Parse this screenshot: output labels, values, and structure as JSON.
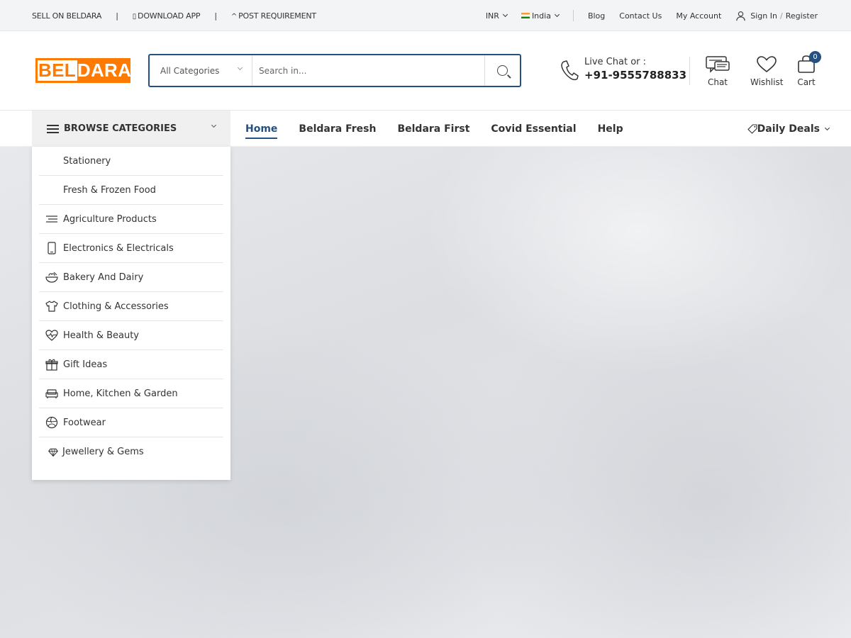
{
  "topbar": {
    "sell": "SELL ON BELDARA",
    "sep": "|",
    "download": "DOWNLOAD APP",
    "post": "POST REQUIREMENT",
    "currency": "INR",
    "country": "India",
    "blog": "Blog",
    "contact": "Contact Us",
    "account": "My Account",
    "signin": "Sign In",
    "slash": "/",
    "register": "Register"
  },
  "header": {
    "logo_part1": "BEL",
    "logo_part2": "DARA",
    "search_category": "All Categories",
    "search_placeholder": "Search in...",
    "contact_line1": "Live Chat or :",
    "contact_phone": "+91-9555788833",
    "chat_label": "Chat",
    "wishlist_label": "Wishlist",
    "cart_label": "Cart",
    "cart_count": "0"
  },
  "nav": {
    "browse_label": "BROWSE CATEGORIES",
    "items": [
      {
        "label": "Home"
      },
      {
        "label": "Beldara Fresh"
      },
      {
        "label": "Beldara First"
      },
      {
        "label": "Covid Essential"
      },
      {
        "label": "Help"
      }
    ],
    "deals_label": "Daily Deals"
  },
  "categories": [
    {
      "label": "Stationery",
      "icon": "none"
    },
    {
      "label": "Fresh & Frozen Food",
      "icon": "none"
    },
    {
      "label": "Agriculture Products",
      "icon": "lines-icon"
    },
    {
      "label": "Electronics & Electricals",
      "icon": "phone-device-icon"
    },
    {
      "label": "Bakery And Dairy",
      "icon": "bowl-icon"
    },
    {
      "label": "Clothing & Accessories",
      "icon": "tshirt-icon"
    },
    {
      "label": "Health & Beauty",
      "icon": "heart-pulse-icon"
    },
    {
      "label": "Gift Ideas",
      "icon": "gift-icon"
    },
    {
      "label": "Home, Kitchen & Garden",
      "icon": "sofa-icon"
    },
    {
      "label": "Footwear",
      "icon": "ball-icon"
    },
    {
      "label": "Jewellery & Gems",
      "icon": "diamond-icon"
    }
  ]
}
